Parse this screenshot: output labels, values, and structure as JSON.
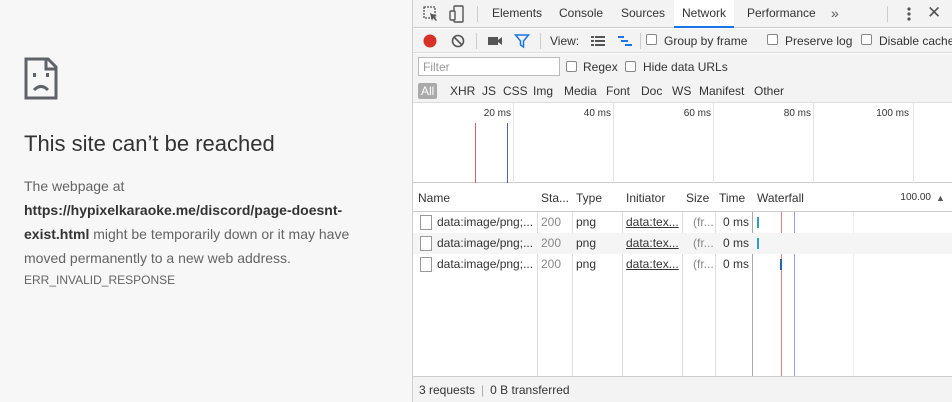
{
  "error_page": {
    "title": "This site can’t be reached",
    "desc_prefix": "The webpage at ",
    "url": "https://hypixelkaraoke.me/discord/page-doesnt-exist.html",
    "desc_suffix": " might be temporarily down or it may have moved permanently to a new web address.",
    "error_code": "ERR_INVALID_RESPONSE"
  },
  "devtools": {
    "tabs": [
      "Elements",
      "Console",
      "Sources",
      "Network",
      "Performance"
    ],
    "active_tab": "Network",
    "more_tabs": "»",
    "toolbar": {
      "view_label": "View:",
      "group_by_frame": "Group by frame",
      "preserve_log": "Preserve log",
      "disable_cache": "Disable cache"
    },
    "filter": {
      "placeholder": "Filter",
      "regex": "Regex",
      "hide_data_urls": "Hide data URLs"
    },
    "types": [
      "All",
      "XHR",
      "JS",
      "CSS",
      "Img",
      "Media",
      "Font",
      "Doc",
      "WS",
      "Manifest",
      "Other"
    ],
    "active_type": "All",
    "overview_ticks": [
      "20 ms",
      "40 ms",
      "60 ms",
      "80 ms",
      "100 ms"
    ],
    "columns": {
      "name": "Name",
      "status": "Sta...",
      "type": "Type",
      "initiator": "Initiator",
      "size": "Size",
      "time": "Time",
      "waterfall": "Waterfall",
      "waterfall_scale": "100.00"
    },
    "rows": [
      {
        "name": "data:image/png;...",
        "status": "200",
        "type": "png",
        "initiator": "data:tex...",
        "size": "(fr...",
        "time": "0 ms"
      },
      {
        "name": "data:image/png;...",
        "status": "200",
        "type": "png",
        "initiator": "data:tex...",
        "size": "(fr...",
        "time": "0 ms"
      },
      {
        "name": "data:image/png;...",
        "status": "200",
        "type": "png",
        "initiator": "data:tex...",
        "size": "(fr...",
        "time": "0 ms"
      }
    ],
    "status_bar": {
      "requests": "3 requests",
      "transferred": "0 B transferred"
    }
  },
  "colors": {
    "record": "#d93025",
    "accent": "#1a73e8",
    "waterfall_bar": "#29a0c8",
    "waterfall_bar_dark": "#2a63b8"
  }
}
